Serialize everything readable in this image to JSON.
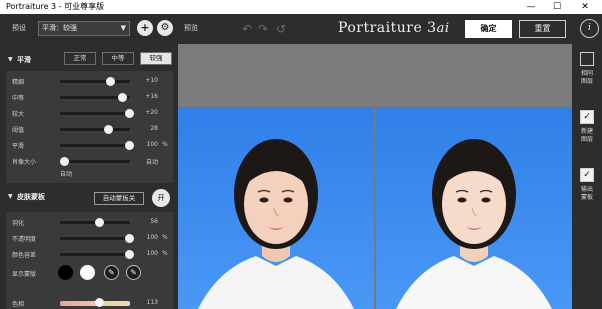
{
  "window": {
    "title": "Portraiture 3 - 可业尊享版",
    "minimize": "—",
    "maximize": "☐",
    "close": "✕"
  },
  "toolbar": {
    "preset_label": "预设",
    "preset_value": "平滑：较强",
    "add_icon": "plus-icon",
    "settings_icon": "gear-icon",
    "preview_label": "预览",
    "brand": "Portraiture 3",
    "brand_suffix": "ai",
    "ok_label": "确定",
    "reset_label": "重置",
    "info_label": "i"
  },
  "smoothing": {
    "title": "平滑",
    "modes": [
      "正常",
      "中等",
      "较强"
    ],
    "active_mode": "较强",
    "sliders": [
      {
        "label": "精细",
        "value": "+10",
        "unit": "",
        "level": 0.72
      },
      {
        "label": "中等",
        "value": "+16",
        "unit": "",
        "level": 0.88
      },
      {
        "label": "较大",
        "value": "+20",
        "unit": "",
        "level": 0.98
      },
      {
        "label": "阈值",
        "value": "28",
        "unit": "",
        "level": 0.68
      },
      {
        "label": "平滑",
        "value": "100",
        "unit": "%",
        "level": 0.98
      },
      {
        "label": "肖像大小",
        "value": "自动",
        "unit": "",
        "level": 0.05
      }
    ],
    "auto_hint": "自动"
  },
  "skin_mask": {
    "title": "皮肤蒙板",
    "auto_mask_label": "自动蒙板关",
    "on_label": "开",
    "sliders": [
      {
        "label": "羽化",
        "value": "56",
        "unit": "",
        "level": 0.55
      },
      {
        "label": "不透明度",
        "value": "100",
        "unit": "%",
        "level": 0.98
      },
      {
        "label": "颜色容差",
        "value": "100",
        "unit": "%",
        "level": 0.98
      }
    ],
    "show_mask_label": "显示蒙版",
    "hue_label": "色相",
    "hue_value": "113",
    "hue_level": 0.55,
    "swatch_colors": [
      "#000000",
      "#ffffff"
    ],
    "picker_icons": [
      "eyedropper-icon",
      "eyedropper-plus-icon"
    ]
  },
  "rail": {
    "items": [
      {
        "label": "相同图层",
        "checked": false
      },
      {
        "label": "新建图层",
        "checked": true
      },
      {
        "label": "输出蒙板",
        "checked": true
      }
    ]
  },
  "colors": {
    "panel": "#2d2d2d",
    "sky_blue": "#3a88ee",
    "accent_white": "#ffffff"
  }
}
